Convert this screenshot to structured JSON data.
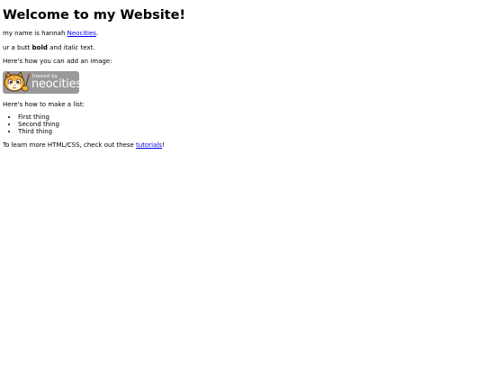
{
  "header": {
    "title": "Welcome to my Website!"
  },
  "intro": {
    "prefix": "my name is hannah ",
    "link_text": "Neocities",
    "suffix": "."
  },
  "style_line": {
    "prefix": "ur a butt ",
    "bold": "bold",
    "middle": " and ",
    "italic": "italic",
    "suffix": " text."
  },
  "image_intro": "Here's how you can add an image:",
  "badge": {
    "hosted_by": "hosted by",
    "brand": "neocities",
    "icon": "neocities-cat-icon",
    "background": "#999999"
  },
  "list_intro": "Here's how to make a list:",
  "list_items": [
    "First thing",
    "Second thing",
    "Third thing"
  ],
  "outro": {
    "prefix": "To learn more HTML/CSS, check out these ",
    "link_text": "tutorials",
    "suffix": "!"
  },
  "colors": {
    "link": "#0000ee",
    "text": "#000000",
    "background": "#ffffff"
  }
}
